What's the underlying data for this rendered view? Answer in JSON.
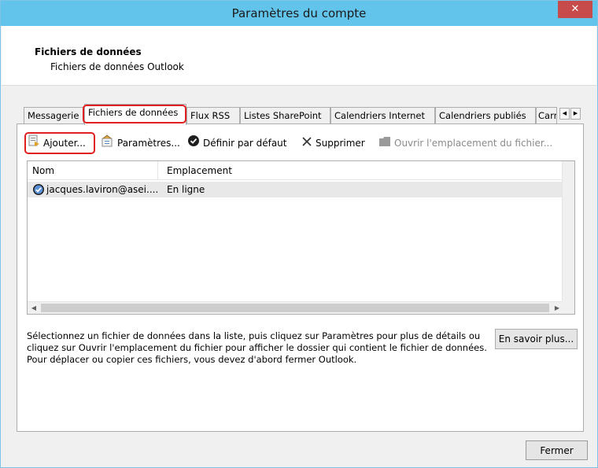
{
  "window": {
    "title": "Paramètres du compte",
    "close_glyph": "✕"
  },
  "header": {
    "title": "Fichiers de données",
    "subtitle": "Fichiers de données Outlook"
  },
  "tabs": [
    {
      "label": "Messagerie",
      "active": false
    },
    {
      "label": "Fichiers de données",
      "active": true
    },
    {
      "label": "Flux RSS",
      "active": false
    },
    {
      "label": "Listes SharePoint",
      "active": false
    },
    {
      "label": "Calendriers Internet",
      "active": false
    },
    {
      "label": "Calendriers publiés",
      "active": false
    },
    {
      "label": "Carnets d'adresses",
      "active": false
    }
  ],
  "tab_scroll": {
    "left": "◀",
    "right": "▶"
  },
  "toolbar": {
    "add": "Ajouter...",
    "settings": "Paramètres...",
    "set_default": "Définir par défaut",
    "delete": "Supprimer",
    "open_location": "Ouvrir l'emplacement du fichier..."
  },
  "list": {
    "columns": [
      "Nom",
      "Emplacement"
    ],
    "rows": [
      {
        "name": "jacques.laviron@asei....",
        "location": "En ligne",
        "default": true
      }
    ]
  },
  "info_text": "Sélectionnez un fichier de données dans la liste, puis cliquez sur Paramètres pour plus de détails ou cliquez sur Ouvrir l'emplacement du fichier pour afficher le dossier qui contient le fichier de données. Pour déplacer ou copier ces fichiers, vous devez d'abord fermer Outlook.",
  "buttons": {
    "learn_more": "En savoir plus...",
    "close": "Fermer"
  },
  "colors": {
    "titlebar": "#63c4eb",
    "close": "#c74b4b",
    "highlight": "#e02020"
  }
}
